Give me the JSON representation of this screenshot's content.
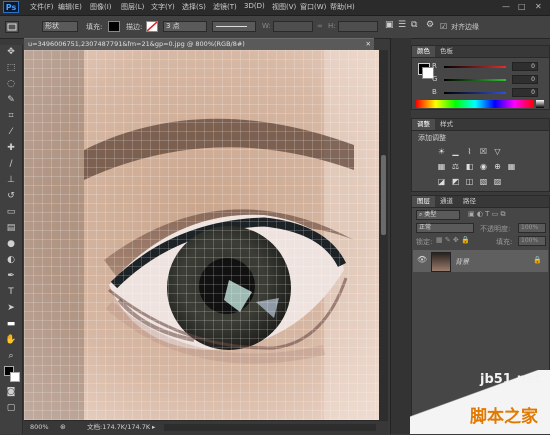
{
  "app": {
    "logo": "Ps"
  },
  "menu": [
    "文件(F)",
    "编辑(E)",
    "图像(I)",
    "图层(L)",
    "文字(Y)",
    "选择(S)",
    "滤镜(T)",
    "3D(D)",
    "视图(V)",
    "窗口(W)",
    "帮助(H)"
  ],
  "window_controls": {
    "minimize": "—",
    "maximize": "□",
    "close": "✕"
  },
  "options": {
    "shape_mode": "形状",
    "fill_label": "填充:",
    "stroke_label": "描边:",
    "stroke_size": "3 点",
    "w_label": "W:",
    "h_label": "H:",
    "align_edges_label": "对齐边缘"
  },
  "document": {
    "tab_title": "u=3496006751,2307487791&fm=21&gp=0.jpg @ 800%(RGB/8#)",
    "zoom": "800%",
    "doc_size": "文档:174.7K/174.7K"
  },
  "color_panel": {
    "tabs": [
      "颜色",
      "色板"
    ],
    "channels": [
      {
        "label": "R",
        "value": "0",
        "color": "#e03030"
      },
      {
        "label": "G",
        "value": "0",
        "color": "#30c030"
      },
      {
        "label": "B",
        "value": "0",
        "color": "#3050e0"
      }
    ]
  },
  "adjust_panel": {
    "tabs": [
      "调整",
      "样式"
    ],
    "title": "添加调整"
  },
  "layers_panel": {
    "tabs": [
      "图层",
      "通道",
      "路径"
    ],
    "kind_filter": "类型",
    "blend_mode": "正常",
    "opacity_label": "不透明度:",
    "opacity": "100%",
    "lock_label": "锁定:",
    "fill_label": "填充:",
    "fill": "100%",
    "layers": [
      {
        "name": "背景",
        "visible_icon": "eye-icon",
        "locked_icon": "lock-icon"
      }
    ]
  },
  "watermark": {
    "site": "jb51.net",
    "name": "脚本之家"
  },
  "colors": {
    "accent": "#4d9cff",
    "panel": "#464646",
    "bg": "#3a3a3a"
  }
}
